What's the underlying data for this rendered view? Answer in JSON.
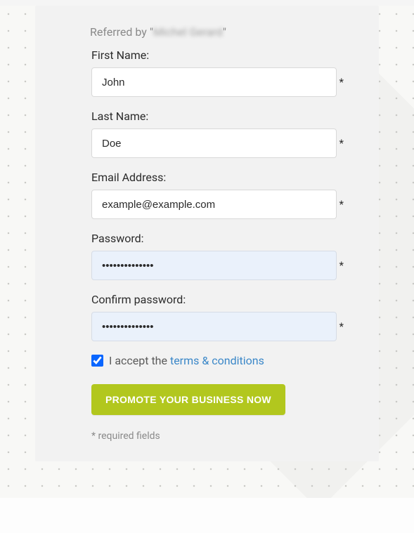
{
  "referred": {
    "prefix": "Referred by \"",
    "name": "Michel Gerard",
    "suffix": "\""
  },
  "fields": {
    "firstName": {
      "label": "First Name:",
      "value": "John"
    },
    "lastName": {
      "label": "Last Name:",
      "value": "Doe"
    },
    "email": {
      "label": "Email Address:",
      "value": "example@example.com"
    },
    "password": {
      "label": "Password:",
      "value": "••••••••••••••"
    },
    "confirmPassword": {
      "label": "Confirm password:",
      "value": "••••••••••••••"
    }
  },
  "asterisk": "*",
  "terms": {
    "checked": true,
    "prefix": "I accept the ",
    "linkText": "terms & conditions"
  },
  "submitLabel": "PROMOTE YOUR BUSINESS NOW",
  "requiredNote": "* required fields"
}
